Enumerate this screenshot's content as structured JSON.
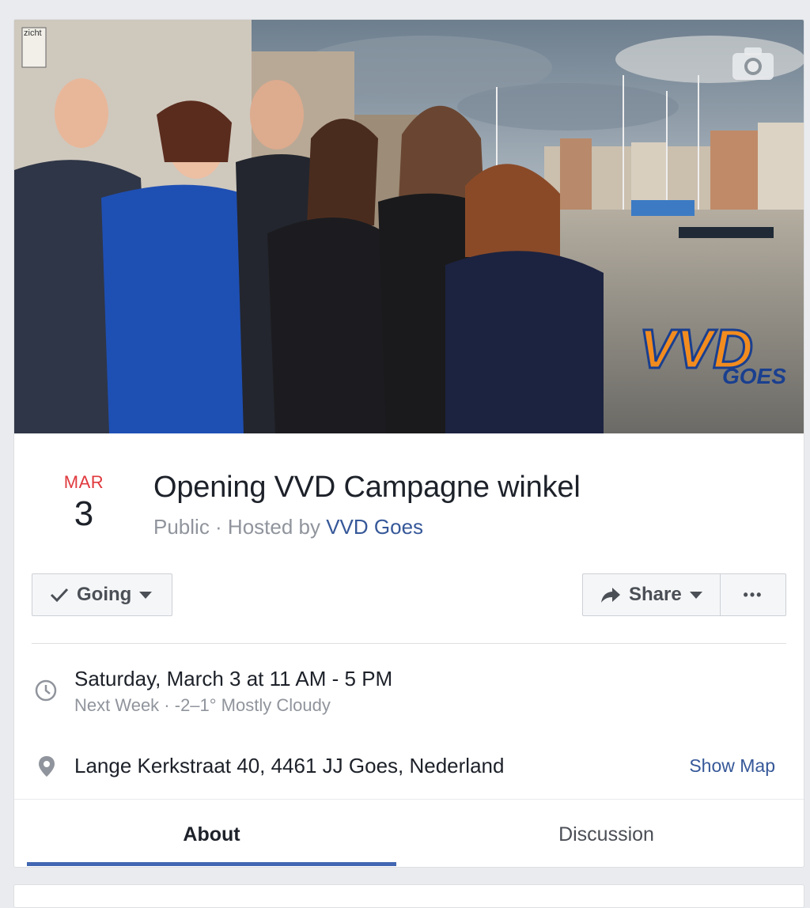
{
  "cover": {
    "logo_text": "VVD",
    "logo_subtext": "GOES",
    "sign_text": "zicht",
    "camera_icon": "camera-icon"
  },
  "event": {
    "month": "MAR",
    "day": "3",
    "title": "Opening VVD Campagne winkel",
    "privacy": "Public · Hosted by ",
    "host": "VVD Goes"
  },
  "actions": {
    "going_label": "Going",
    "share_label": "Share",
    "more_label": "•••"
  },
  "details": {
    "time": "Saturday, March 3 at 11 AM - 5 PM",
    "time_sub": "Next Week · -2–1° Mostly Cloudy",
    "location": "Lange Kerkstraat 40, 4461 JJ Goes, Nederland",
    "show_map": "Show Map"
  },
  "tabs": [
    {
      "label": "About",
      "active": true
    },
    {
      "label": "Discussion",
      "active": false
    }
  ],
  "colors": {
    "accent": "#4267b2",
    "link": "#365899",
    "date_red": "#e0393e",
    "vvd_orange": "#f28c1f",
    "vvd_blue": "#1a3f8f"
  }
}
